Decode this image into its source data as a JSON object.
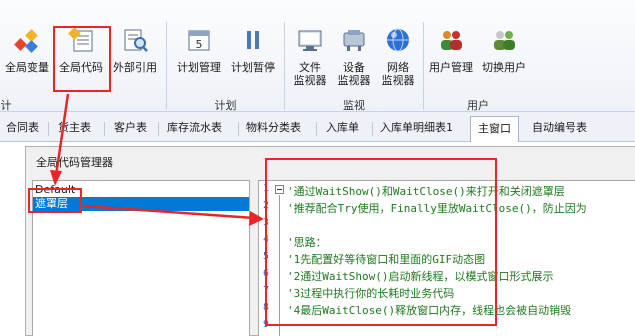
{
  "ribbon": {
    "buttons": [
      {
        "label": "全局变量",
        "icon": "global-variable-icon"
      },
      {
        "label": "全局代码",
        "icon": "global-code-icon"
      },
      {
        "label": "外部引用",
        "icon": "external-reference-icon"
      },
      {
        "label": "计划管理",
        "icon": "schedule-manage-icon"
      },
      {
        "label": "计划暂停",
        "icon": "pause-icon"
      },
      {
        "label": "文件",
        "label2": "监视器",
        "icon": "file-monitor-icon"
      },
      {
        "label": "设备",
        "label2": "监视器",
        "icon": "device-monitor-icon"
      },
      {
        "label": "网络",
        "label2": "监视器",
        "icon": "network-monitor-icon"
      },
      {
        "label": "用户管理",
        "icon": "user-manage-icon"
      },
      {
        "label": "切换用户",
        "icon": "switch-user-icon"
      }
    ],
    "groups": {
      "left": "计",
      "plan": "计划",
      "monitor": "监视",
      "user": "用户"
    }
  },
  "tabs": [
    "合同表",
    "货主表",
    "客户表",
    "库存流水表",
    "物料分类表",
    "入库单",
    "入库单明细表1",
    "主窗口",
    "自动编号表"
  ],
  "dialog": {
    "title": "全局代码管理器",
    "tree": [
      "Default",
      "遮罩层"
    ],
    "line_numbers": [
      "1",
      "2",
      "3",
      "4",
      "5",
      "6",
      "7",
      "8",
      "9"
    ],
    "code_lines": [
      "'通过WaitShow()和WaitClose()来打开和关闭遮罩层",
      "'推荐配合Try使用，Finally里放WaitClose()，防止因为",
      "",
      "'思路：",
      "'1先配置好等待窗口和里面的GIF动态图",
      "'2通过WaitShow()启动新线程，以模式窗口形式展示",
      "'3过程中执行你的长耗时业务代码",
      "'4最后WaitClose()释放窗口内存，线程也会被自动销毁",
      ""
    ]
  },
  "colors": {
    "annotation": "#e8262a",
    "selection": "#0078d7",
    "comment": "#1f7a1f"
  }
}
